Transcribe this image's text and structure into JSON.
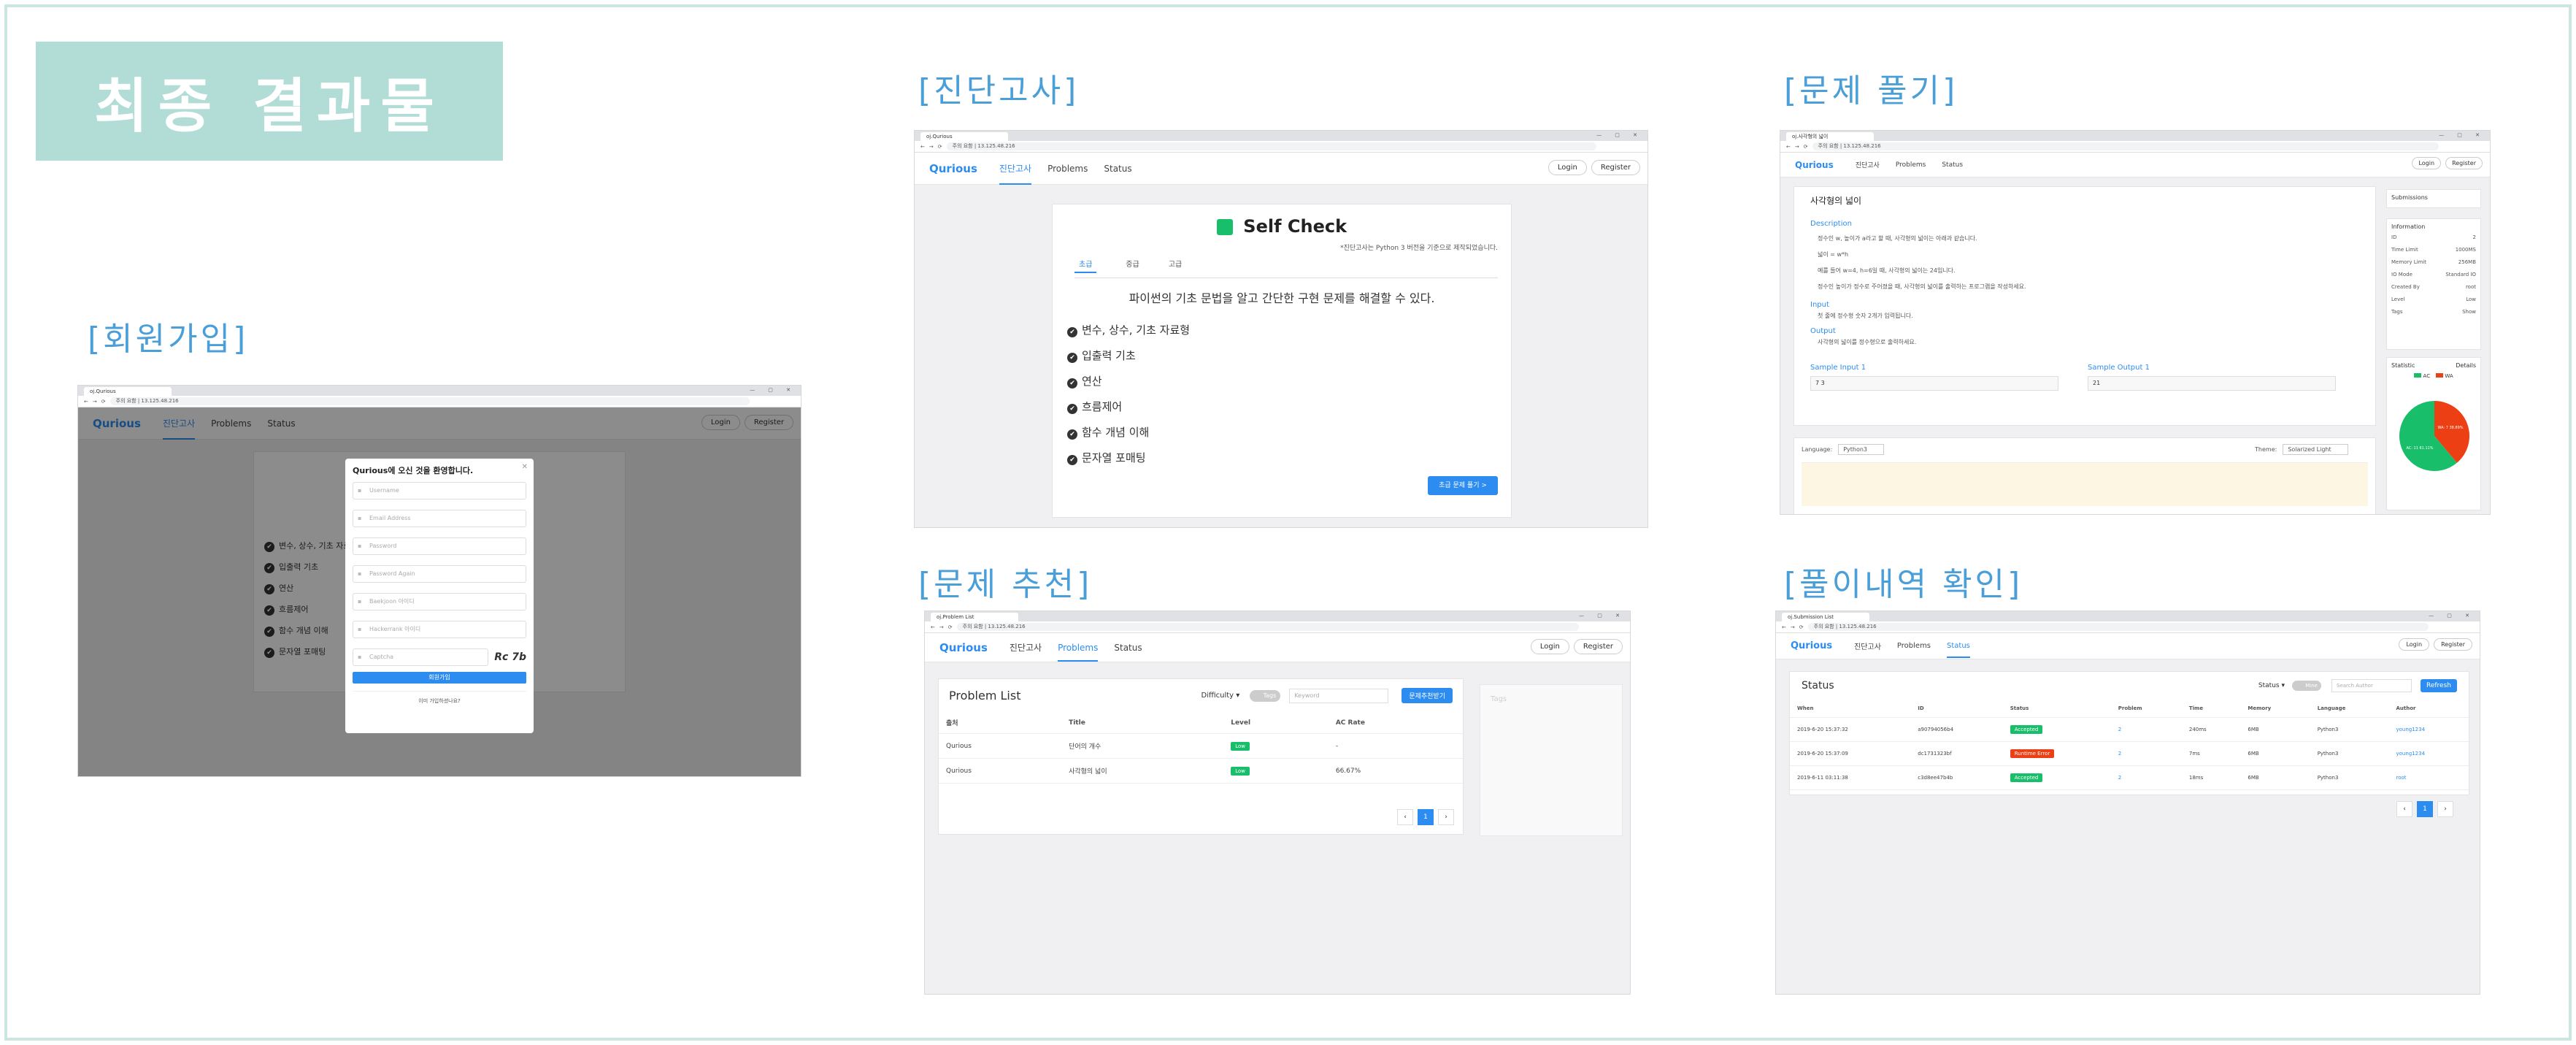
{
  "page": {
    "main_title": "최종 결과물",
    "labels": {
      "signup": "[회원가입]",
      "diagnosis": "[진단고사]",
      "solve": "[문제 풀기]",
      "recommend": "[문제 추천]",
      "history": "[풀이내역 확인]"
    },
    "accent": "#b2ddd7",
    "label_color": "#4a9fd8"
  },
  "common": {
    "tab_title": "oj.Qurious",
    "tab_problem": "oj.Problem List",
    "tab_status": "oj.Submission List",
    "tab_solve": "oj.사각형의 넓이",
    "address": "주의 요함 | 13.125.48.216",
    "logo": "Qurious",
    "nav": [
      "진단고사",
      "Problems",
      "Status"
    ],
    "login": "Login",
    "register": "Register"
  },
  "signup": {
    "modal_title": "Qurious에 오신 것을 환영합니다.",
    "fields": [
      "Username",
      "Email Address",
      "Password",
      "Password Again",
      "Baekjoon 아이디",
      "Hackerrank 아이디",
      "Captcha"
    ],
    "captcha_text": "Rc 7b",
    "submit": "회원가입",
    "link": "이미 가입하셨나요?"
  },
  "diagnosis": {
    "title": "Self Check",
    "note": "*진단고사는 Python 3 버전을 기준으로 제작되었습니다.",
    "tabs": [
      "초급",
      "중급",
      "고급"
    ],
    "headline": "파이썬의 기초 문법을 알고 간단한 구현 문제를 해결할 수 있다.",
    "items": [
      "변수, 상수, 기초 자료형",
      "입출력 기초",
      "연산",
      "흐름제어",
      "함수 개념 이해",
      "문자열 포매팅"
    ],
    "button": "초급 문제 풀기 >"
  },
  "solve": {
    "problem_title": "사각형의 넓이",
    "description_h": "Description",
    "description": [
      "정수인 w, 높이가 a라고 할 때, 사각형의 넓이는 아래과 같습니다.",
      "넓이 = w*h",
      "예를 들어 w=4, h=6일 때, 사각형의 넓이는 24입니다.",
      "정수인 높이가 정수로 주어졌을 때, 사각형의 넓이를 출력하는 프로그램을 작성하세요."
    ],
    "input_h": "Input",
    "input": "첫 줄에 정수형 숫자 2개가 입력됩니다.",
    "output_h": "Output",
    "output": "사각형의 넓이를 정수형으로 출력하세요.",
    "sample_in_h": "Sample Input 1",
    "sample_in": "7 3",
    "sample_out_h": "Sample Output 1",
    "sample_out": "21",
    "language_label": "Language:",
    "language": "Python3",
    "theme_label": "Theme:",
    "theme": "Solarized Light",
    "side_submissions": "Submissions",
    "side_info": "Information",
    "info_rows": [
      [
        "ID",
        "2"
      ],
      [
        "Time Limit",
        "1000MS"
      ],
      [
        "Memory Limit",
        "256MB"
      ],
      [
        "IO Mode",
        "Standard IO"
      ],
      [
        "Created By",
        "root"
      ],
      [
        "Level",
        "Low"
      ],
      [
        "Tags",
        "Show"
      ]
    ],
    "side_stats": "Statistic",
    "side_details": "Details",
    "legend": [
      "AC",
      "WA"
    ],
    "pie_ac": 61.1,
    "pie_labels": [
      "WA: 7 38.89%",
      "AC: 11 61.11%"
    ]
  },
  "recommend": {
    "title": "Problem List",
    "difficulty": "Difficulty",
    "tags": "Tags",
    "search": "Keyword",
    "button": "문제추천받기",
    "columns": [
      "출처",
      "Title",
      "Level",
      "AC Rate"
    ],
    "rows": [
      [
        "Qurious",
        "단어의 개수",
        "Low",
        "-"
      ],
      [
        "Qurious",
        "사각형의 넓이",
        "Low",
        "66.67%"
      ]
    ],
    "side_title": "Tags",
    "page": "1"
  },
  "history": {
    "title": "Status",
    "filter": "Status",
    "mine": "Mine",
    "search": "Search Author",
    "refresh": "Refresh",
    "columns": [
      "When",
      "ID",
      "Status",
      "Problem",
      "Time",
      "Memory",
      "Language",
      "Author"
    ],
    "rows": [
      [
        "2019-6-20 15:37:32",
        "a90794056b4",
        "Accepted",
        "2",
        "240ms",
        "6MB",
        "Python3",
        "young1234"
      ],
      [
        "2019-6-20 15:37:09",
        "dc1731323bf",
        "Runtime Error",
        "2",
        "7ms",
        "6MB",
        "Python3",
        "young1234"
      ],
      [
        "2019-6-11 03:11:38",
        "c3d8ee47b4b",
        "Accepted",
        "2",
        "18ms",
        "6MB",
        "Python3",
        "root"
      ]
    ],
    "page": "1"
  }
}
